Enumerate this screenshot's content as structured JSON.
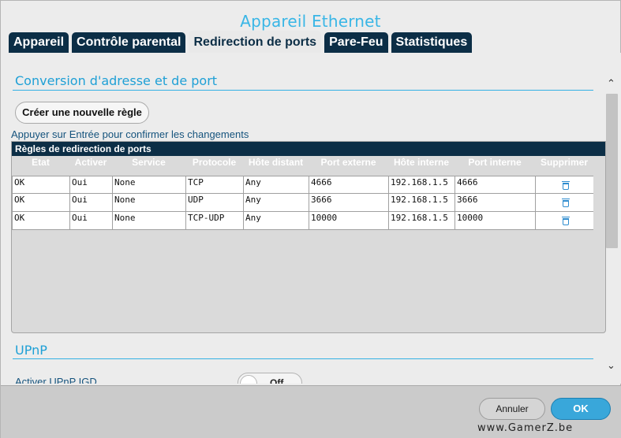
{
  "window": {
    "title": "Appareil Ethernet"
  },
  "tabs": [
    {
      "label": "Appareil"
    },
    {
      "label": "Contrôle parental"
    },
    {
      "label": "Redirection de ports"
    },
    {
      "label": "Pare-Feu"
    },
    {
      "label": "Statistiques"
    }
  ],
  "active_tab": "Redirection de ports",
  "nat_section": {
    "title": "Conversion d'adresse et de port",
    "new_rule_button": "Créer une nouvelle règle",
    "hint": "Appuyer sur Entrée pour confirmer les changements"
  },
  "table": {
    "title": "Règles de redirection de ports",
    "columns": [
      "Etat",
      "Activer",
      "Service",
      "Protocole",
      "Hôte distant",
      "Port externe",
      "Hôte interne",
      "Port interne",
      "Supprimer"
    ],
    "rows": [
      {
        "etat": "OK",
        "activer": "Oui",
        "service": "None",
        "protocole": "TCP",
        "hote_distant": "Any",
        "port_externe": "4666",
        "hote_interne": "192.168.1.5",
        "port_interne": "4666"
      },
      {
        "etat": "OK",
        "activer": "Oui",
        "service": "None",
        "protocole": "UDP",
        "hote_distant": "Any",
        "port_externe": "3666",
        "hote_interne": "192.168.1.5",
        "port_interne": "3666"
      },
      {
        "etat": "OK",
        "activer": "Oui",
        "service": "None",
        "protocole": "TCP-UDP",
        "hote_distant": "Any",
        "port_externe": "10000",
        "hote_interne": "192.168.1.5",
        "port_interne": "10000"
      }
    ]
  },
  "upnp_section": {
    "title": "UPnP",
    "label": "Activer UPnP IGD",
    "toggle_state": "Off"
  },
  "footer": {
    "cancel_label": "Annuler",
    "ok_label": "OK",
    "watermark_logo": "GamerZ",
    "watermark_url": "www.GamerZ.be"
  },
  "colors": {
    "accent": "#39b6e6",
    "tab_bg": "#0c2e46",
    "ok_button": "#39a7da"
  }
}
